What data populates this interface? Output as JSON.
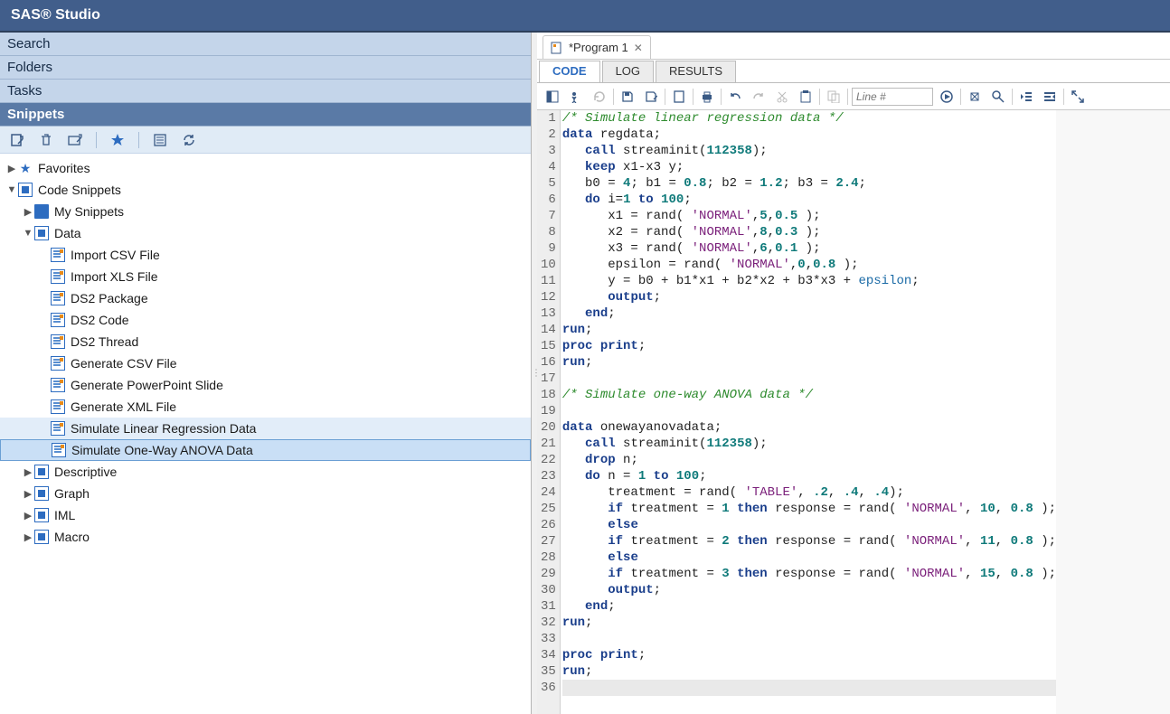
{
  "app_title": "SAS® Studio",
  "left_panels": {
    "search": "Search",
    "folders": "Folders",
    "tasks": "Tasks",
    "snippets": "Snippets"
  },
  "tree": {
    "favorites": "Favorites",
    "code_snippets": "Code Snippets",
    "my_snippets": "My Snippets",
    "data": "Data",
    "data_items": [
      "Import CSV File",
      "Import XLS File",
      "DS2 Package",
      "DS2 Code",
      "DS2 Thread",
      "Generate CSV File",
      "Generate PowerPoint Slide",
      "Generate XML File",
      "Simulate Linear Regression Data",
      "Simulate One-Way ANOVA Data"
    ],
    "siblings": [
      "Descriptive",
      "Graph",
      "IML",
      "Macro"
    ]
  },
  "tab": {
    "label": "*Program 1"
  },
  "subtabs": {
    "code": "CODE",
    "log": "LOG",
    "results": "RESULTS"
  },
  "line_placeholder": "Line #",
  "code_lines": [
    [
      [
        "cmt",
        "/* Simulate linear regression data */"
      ]
    ],
    [
      [
        "kw",
        "data"
      ],
      [
        "id",
        " regdata;"
      ]
    ],
    [
      [
        "id",
        "   "
      ],
      [
        "kw",
        "call"
      ],
      [
        "id",
        " streaminit("
      ],
      [
        "num",
        "112358"
      ],
      [
        "id",
        ");"
      ]
    ],
    [
      [
        "id",
        "   "
      ],
      [
        "kw",
        "keep"
      ],
      [
        "id",
        " x1-x3 y;"
      ]
    ],
    [
      [
        "id",
        "   b0 = "
      ],
      [
        "num",
        "4"
      ],
      [
        "id",
        "; b1 = "
      ],
      [
        "num",
        "0.8"
      ],
      [
        "id",
        "; b2 = "
      ],
      [
        "num",
        "1.2"
      ],
      [
        "id",
        "; b3 = "
      ],
      [
        "num",
        "2.4"
      ],
      [
        "id",
        ";"
      ]
    ],
    [
      [
        "id",
        "   "
      ],
      [
        "kw",
        "do"
      ],
      [
        "id",
        " i="
      ],
      [
        "num",
        "1"
      ],
      [
        "id",
        " "
      ],
      [
        "kw",
        "to"
      ],
      [
        "id",
        " "
      ],
      [
        "num",
        "100"
      ],
      [
        "id",
        ";"
      ]
    ],
    [
      [
        "id",
        "      x1 = rand( "
      ],
      [
        "str",
        "'NORMAL'"
      ],
      [
        "id",
        ","
      ],
      [
        "num",
        "5"
      ],
      [
        "id",
        ","
      ],
      [
        "num",
        "0.5"
      ],
      [
        "id",
        " );"
      ]
    ],
    [
      [
        "id",
        "      x2 = rand( "
      ],
      [
        "str",
        "'NORMAL'"
      ],
      [
        "id",
        ","
      ],
      [
        "num",
        "8"
      ],
      [
        "id",
        ","
      ],
      [
        "num",
        "0.3"
      ],
      [
        "id",
        " );"
      ]
    ],
    [
      [
        "id",
        "      x3 = rand( "
      ],
      [
        "str",
        "'NORMAL'"
      ],
      [
        "id",
        ","
      ],
      [
        "num",
        "6"
      ],
      [
        "id",
        ","
      ],
      [
        "num",
        "0.1"
      ],
      [
        "id",
        " );"
      ]
    ],
    [
      [
        "id",
        "      epsilon = rand( "
      ],
      [
        "str",
        "'NORMAL'"
      ],
      [
        "id",
        ","
      ],
      [
        "num",
        "0"
      ],
      [
        "id",
        ","
      ],
      [
        "num",
        "0.8"
      ],
      [
        "id",
        " );"
      ]
    ],
    [
      [
        "id",
        "      y = b0 + b1*x1 + b2*x2 + b3*x3 + "
      ],
      [
        "opt",
        "epsilon"
      ],
      [
        "id",
        ";"
      ]
    ],
    [
      [
        "id",
        "      "
      ],
      [
        "kw",
        "output"
      ],
      [
        "id",
        ";"
      ]
    ],
    [
      [
        "id",
        "   "
      ],
      [
        "kw",
        "end"
      ],
      [
        "id",
        ";"
      ]
    ],
    [
      [
        "kw",
        "run"
      ],
      [
        "id",
        ";"
      ]
    ],
    [
      [
        "kw",
        "proc"
      ],
      [
        "id",
        " "
      ],
      [
        "kw",
        "print"
      ],
      [
        "id",
        ";"
      ]
    ],
    [
      [
        "kw",
        "run"
      ],
      [
        "id",
        ";"
      ]
    ],
    [
      [
        "id",
        ""
      ]
    ],
    [
      [
        "cmt",
        "/* Simulate one-way ANOVA data */"
      ]
    ],
    [
      [
        "id",
        ""
      ]
    ],
    [
      [
        "kw",
        "data"
      ],
      [
        "id",
        " onewayanovadata;"
      ]
    ],
    [
      [
        "id",
        "   "
      ],
      [
        "kw",
        "call"
      ],
      [
        "id",
        " streaminit("
      ],
      [
        "num",
        "112358"
      ],
      [
        "id",
        ");"
      ]
    ],
    [
      [
        "id",
        "   "
      ],
      [
        "kw",
        "drop"
      ],
      [
        "id",
        " n;"
      ]
    ],
    [
      [
        "id",
        "   "
      ],
      [
        "kw",
        "do"
      ],
      [
        "id",
        " n = "
      ],
      [
        "num",
        "1"
      ],
      [
        "id",
        " "
      ],
      [
        "kw",
        "to"
      ],
      [
        "id",
        " "
      ],
      [
        "num",
        "100"
      ],
      [
        "id",
        ";"
      ]
    ],
    [
      [
        "id",
        "      treatment = rand( "
      ],
      [
        "str",
        "'TABLE'"
      ],
      [
        "id",
        ", "
      ],
      [
        "num",
        ".2"
      ],
      [
        "id",
        ", "
      ],
      [
        "num",
        ".4"
      ],
      [
        "id",
        ", "
      ],
      [
        "num",
        ".4"
      ],
      [
        "id",
        ");"
      ]
    ],
    [
      [
        "id",
        "      "
      ],
      [
        "kw",
        "if"
      ],
      [
        "id",
        " treatment = "
      ],
      [
        "num",
        "1"
      ],
      [
        "id",
        " "
      ],
      [
        "kw",
        "then"
      ],
      [
        "id",
        " response = rand( "
      ],
      [
        "str",
        "'NORMAL'"
      ],
      [
        "id",
        ", "
      ],
      [
        "num",
        "10"
      ],
      [
        "id",
        ", "
      ],
      [
        "num",
        "0.8"
      ],
      [
        "id",
        " );"
      ]
    ],
    [
      [
        "id",
        "      "
      ],
      [
        "kw",
        "else"
      ]
    ],
    [
      [
        "id",
        "      "
      ],
      [
        "kw",
        "if"
      ],
      [
        "id",
        " treatment = "
      ],
      [
        "num",
        "2"
      ],
      [
        "id",
        " "
      ],
      [
        "kw",
        "then"
      ],
      [
        "id",
        " response = rand( "
      ],
      [
        "str",
        "'NORMAL'"
      ],
      [
        "id",
        ", "
      ],
      [
        "num",
        "11"
      ],
      [
        "id",
        ", "
      ],
      [
        "num",
        "0.8"
      ],
      [
        "id",
        " );"
      ]
    ],
    [
      [
        "id",
        "      "
      ],
      [
        "kw",
        "else"
      ]
    ],
    [
      [
        "id",
        "      "
      ],
      [
        "kw",
        "if"
      ],
      [
        "id",
        " treatment = "
      ],
      [
        "num",
        "3"
      ],
      [
        "id",
        " "
      ],
      [
        "kw",
        "then"
      ],
      [
        "id",
        " response = rand( "
      ],
      [
        "str",
        "'NORMAL'"
      ],
      [
        "id",
        ", "
      ],
      [
        "num",
        "15"
      ],
      [
        "id",
        ", "
      ],
      [
        "num",
        "0.8"
      ],
      [
        "id",
        " );"
      ]
    ],
    [
      [
        "id",
        "      "
      ],
      [
        "kw",
        "output"
      ],
      [
        "id",
        ";"
      ]
    ],
    [
      [
        "id",
        "   "
      ],
      [
        "kw",
        "end"
      ],
      [
        "id",
        ";"
      ]
    ],
    [
      [
        "kw",
        "run"
      ],
      [
        "id",
        ";"
      ]
    ],
    [
      [
        "id",
        ""
      ]
    ],
    [
      [
        "kw",
        "proc"
      ],
      [
        "id",
        " "
      ],
      [
        "kw",
        "print"
      ],
      [
        "id",
        ";"
      ]
    ],
    [
      [
        "kw",
        "run"
      ],
      [
        "id",
        ";"
      ]
    ],
    [
      [
        "id",
        ""
      ]
    ]
  ],
  "total_lines": 36
}
